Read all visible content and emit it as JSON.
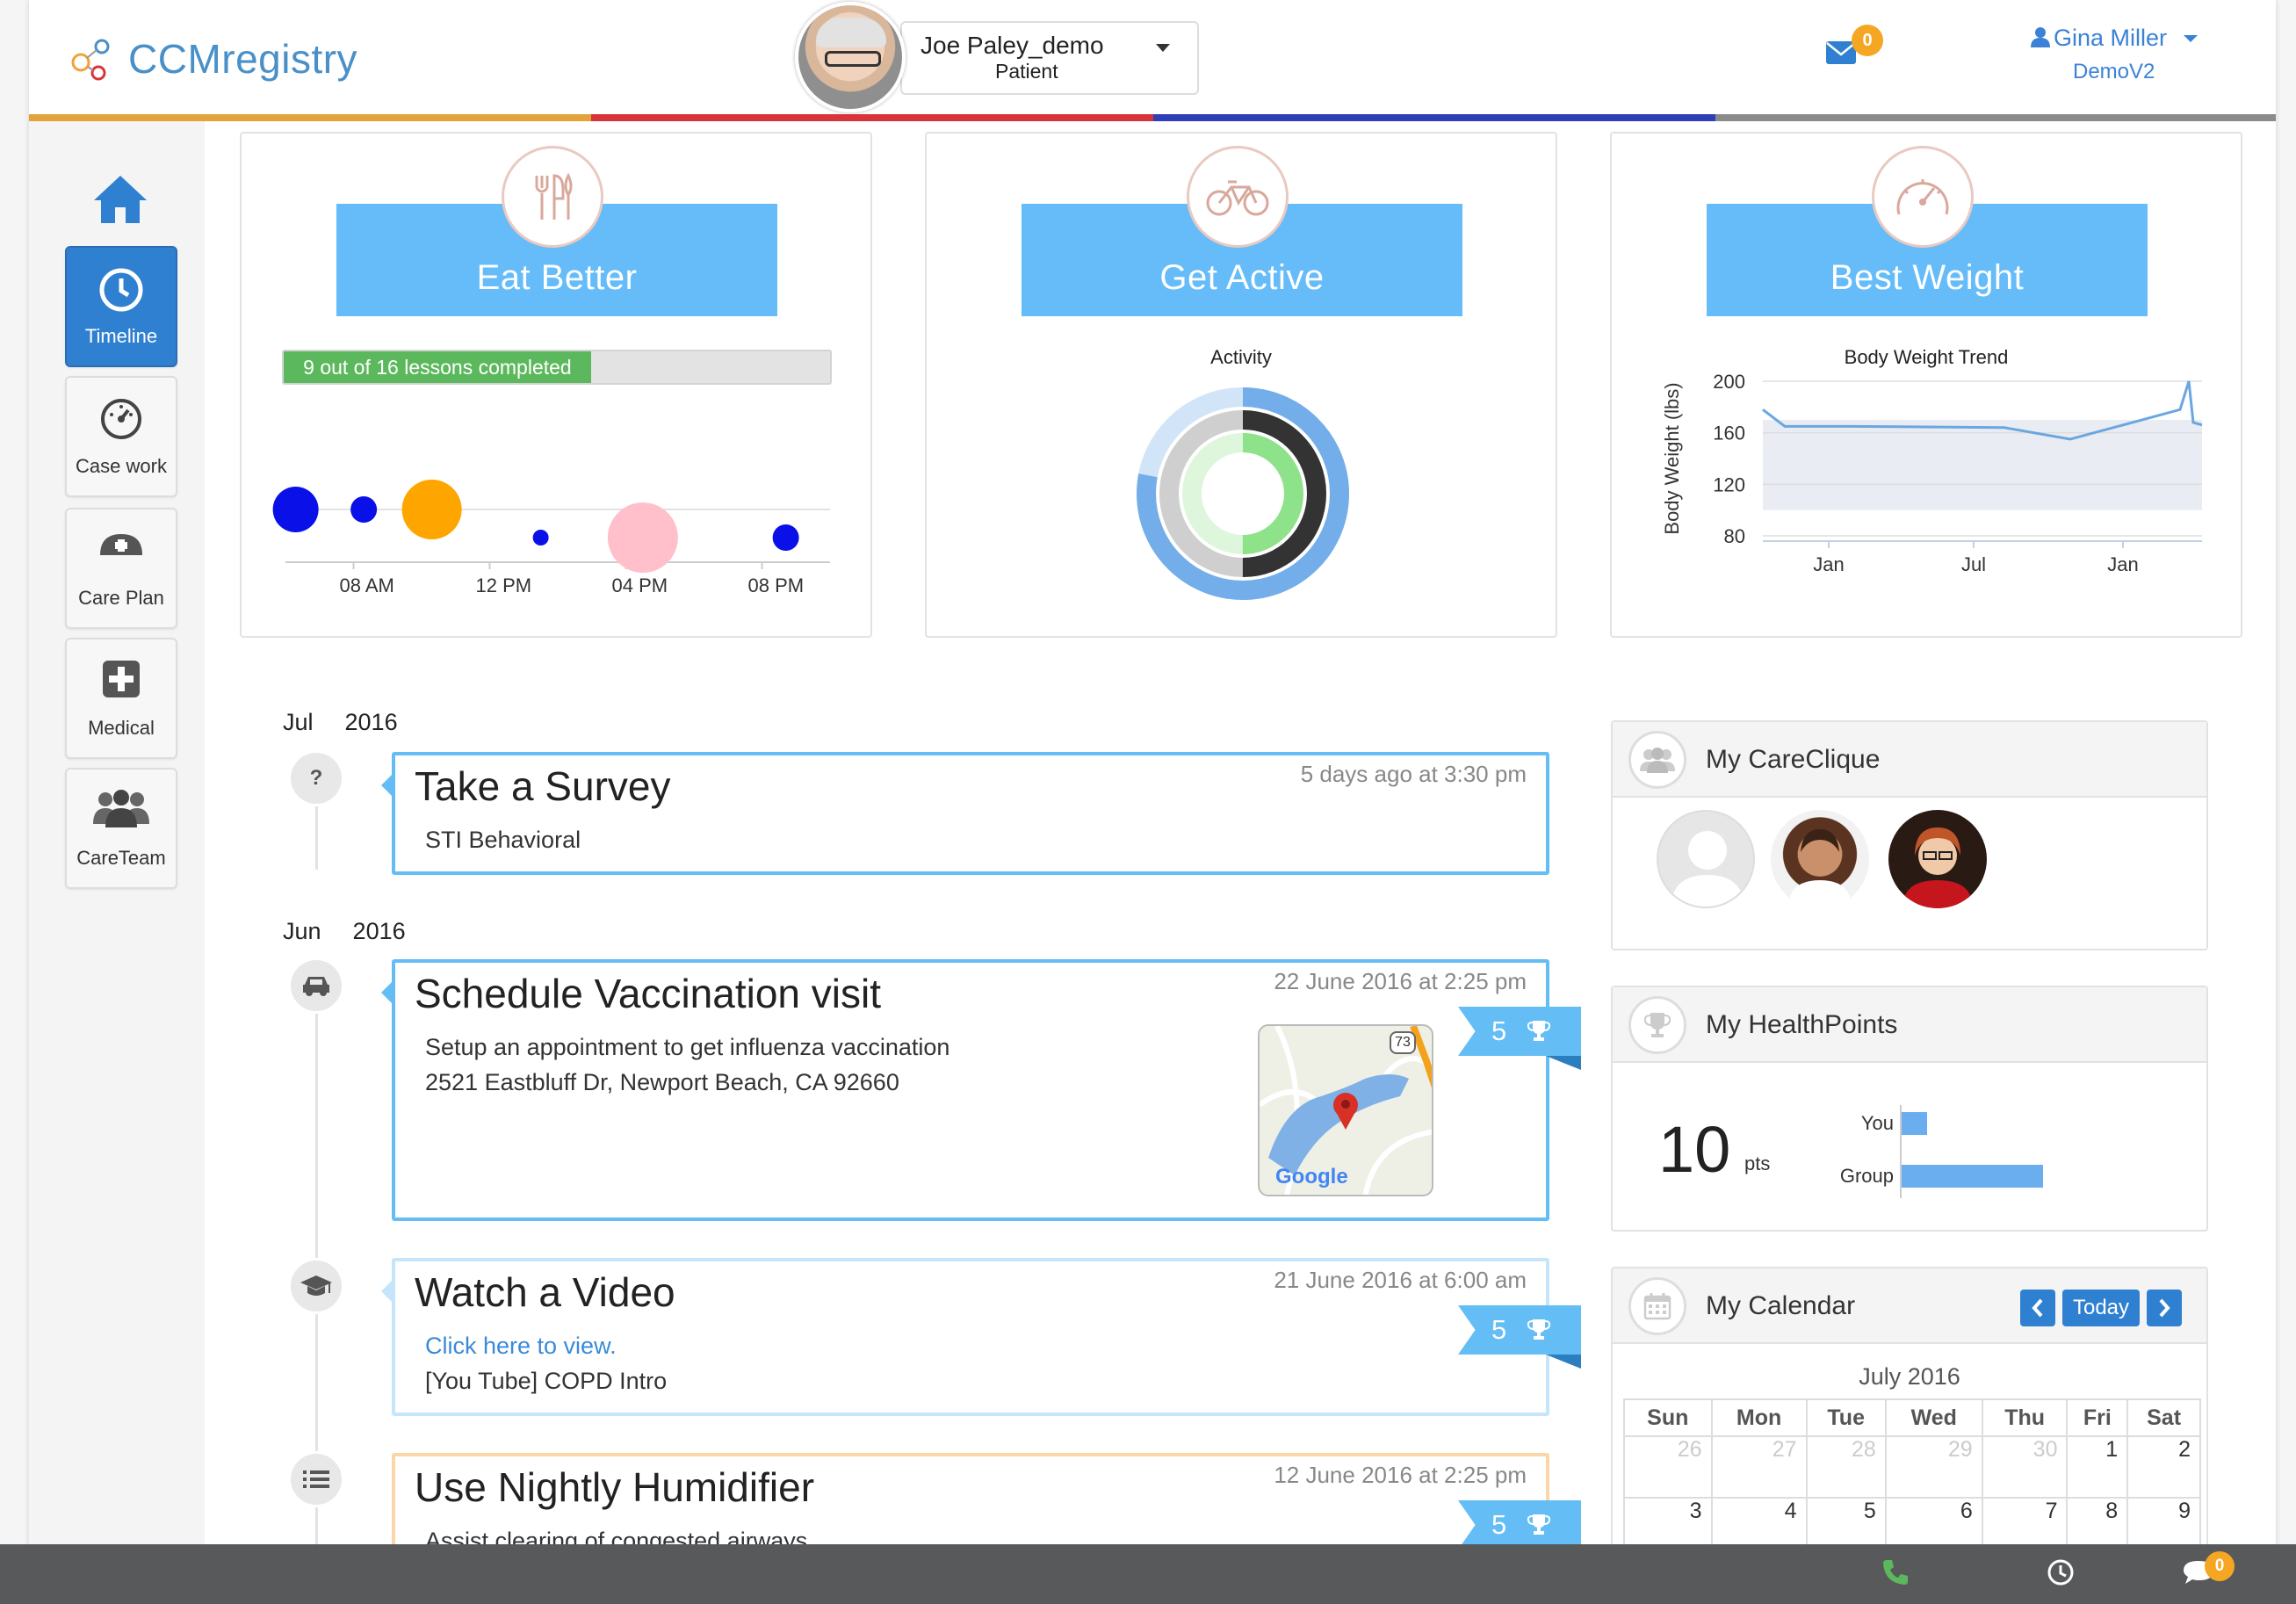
{
  "header": {
    "logo_text": "CCMregistry",
    "patient_name": "Joe Paley_demo",
    "patient_role": "Patient",
    "mail_count": "0",
    "user_name": "Gina Miller",
    "user_org": "DemoV2",
    "stripe_colors": [
      "#e2a43a",
      "#d9343a",
      "#2f3fb7",
      "#8a8a8a"
    ]
  },
  "sidebar": {
    "items": [
      {
        "label": "Timeline",
        "icon": "clock-icon",
        "active": true
      },
      {
        "label": "Case work",
        "icon": "dashboard-icon",
        "active": false
      },
      {
        "label": "Care Plan",
        "icon": "nurse-cap-icon",
        "active": false
      },
      {
        "label": "Medical",
        "icon": "medical-plus-icon",
        "active": false
      },
      {
        "label": "CareTeam",
        "icon": "team-icon",
        "active": false
      }
    ]
  },
  "cards": {
    "eat": {
      "title": "Eat Better",
      "icon": "fork-knife-icon",
      "progress_label": "9 out of 16 lessons completed",
      "progress_value": 0.5625
    },
    "active": {
      "title": "Get Active",
      "icon": "bicycle-icon",
      "chart_title": "Activity"
    },
    "weight": {
      "title": "Best Weight",
      "icon": "gauge-icon",
      "chart_title": "Body Weight Trend",
      "ylabel": "Body Weight (lbs)"
    }
  },
  "chart_data": [
    {
      "type": "scatter",
      "title": "",
      "x_ticks": [
        "08 AM",
        "12 PM",
        "04 PM",
        "08 PM"
      ],
      "x_range": [
        6,
        22
      ],
      "points": [
        {
          "x": 6.3,
          "level": "high",
          "size": 3,
          "color": "#0a10e8"
        },
        {
          "x": 8.3,
          "level": "high",
          "size": 2,
          "color": "#0a10e8"
        },
        {
          "x": 10.3,
          "level": "high",
          "size": 4,
          "color": "#ffa500"
        },
        {
          "x": 13.5,
          "level": "low",
          "size": 1,
          "color": "#0a10e8"
        },
        {
          "x": 16.5,
          "level": "low",
          "size": 5,
          "color": "#ffc0cb"
        },
        {
          "x": 20.7,
          "level": "low",
          "size": 2,
          "color": "#0a10e8"
        }
      ]
    },
    {
      "type": "pie",
      "title": "Activity",
      "rings": [
        {
          "color": "#74aeea",
          "track": "#d2e4f7",
          "value": 0.78
        },
        {
          "color": "#333333",
          "track": "#cfcfcf",
          "value": 0.5
        },
        {
          "color": "#8ee28a",
          "track": "#def7dc",
          "value": 0.5
        }
      ]
    },
    {
      "type": "line",
      "title": "Body Weight Trend",
      "ylabel": "Body Weight (lbs)",
      "y_ticks": [
        80,
        120,
        160,
        200
      ],
      "ylim": [
        80,
        200
      ],
      "x_ticks": [
        "Jan",
        "Jul",
        "Jan"
      ],
      "band": [
        100,
        170
      ],
      "series": [
        {
          "color": "#6aa7e0",
          "points": [
            [
              0,
              178
            ],
            [
              0.05,
              165
            ],
            [
              0.2,
              165
            ],
            [
              0.55,
              164
            ],
            [
              0.7,
              155
            ],
            [
              0.95,
              178
            ],
            [
              0.97,
              200
            ],
            [
              0.98,
              168
            ],
            [
              1.0,
              166
            ]
          ]
        }
      ]
    }
  ],
  "timeline": {
    "months": [
      {
        "month": "Jul",
        "year": "2016"
      },
      {
        "month": "Jun",
        "year": "2016"
      }
    ],
    "items": [
      {
        "title": "Take a Survey",
        "time": "5 days ago at 3:30 pm",
        "lines": [
          "STI Behavioral"
        ],
        "icon": "question-icon"
      },
      {
        "title": "Schedule Vaccination visit",
        "time": "22 June 2016 at 2:25 pm",
        "lines": [
          "Setup an appointment to get influenza vaccination",
          "2521 Eastbluff Dr, Newport Beach, CA 92660"
        ],
        "points": "5",
        "icon": "car-icon",
        "map_label": "Google",
        "map_road": "73"
      },
      {
        "title": "Watch a Video",
        "time": "21 June 2016 at 6:00 am",
        "link": "Click here to view.",
        "lines": [
          "[You Tube] COPD Intro"
        ],
        "points": "5",
        "icon": "graduation-cap-icon"
      },
      {
        "title": "Use Nightly Humidifier",
        "time": "12 June 2016 at 2:25 pm",
        "lines": [
          "Assist clearing of congested airways"
        ],
        "points": "5",
        "icon": "list-icon"
      }
    ]
  },
  "widgets": {
    "careclique": {
      "title": "My CareClique"
    },
    "healthpoints": {
      "title": "My HealthPoints",
      "points": "10",
      "unit": "pts",
      "bars": [
        {
          "label": "You",
          "value": 10
        },
        {
          "label": "Group",
          "value": 54
        }
      ]
    },
    "calendar": {
      "title": "My Calendar",
      "today_label": "Today",
      "month_label": "July 2016",
      "weekdays": [
        "Sun",
        "Mon",
        "Tue",
        "Wed",
        "Thu",
        "Fri",
        "Sat"
      ],
      "week1": [
        "26",
        "27",
        "28",
        "29",
        "30",
        "1",
        "2"
      ],
      "week2": [
        "3",
        "4",
        "5",
        "6",
        "7",
        "8",
        "9"
      ]
    }
  },
  "footer": {
    "chat_count": "0"
  }
}
